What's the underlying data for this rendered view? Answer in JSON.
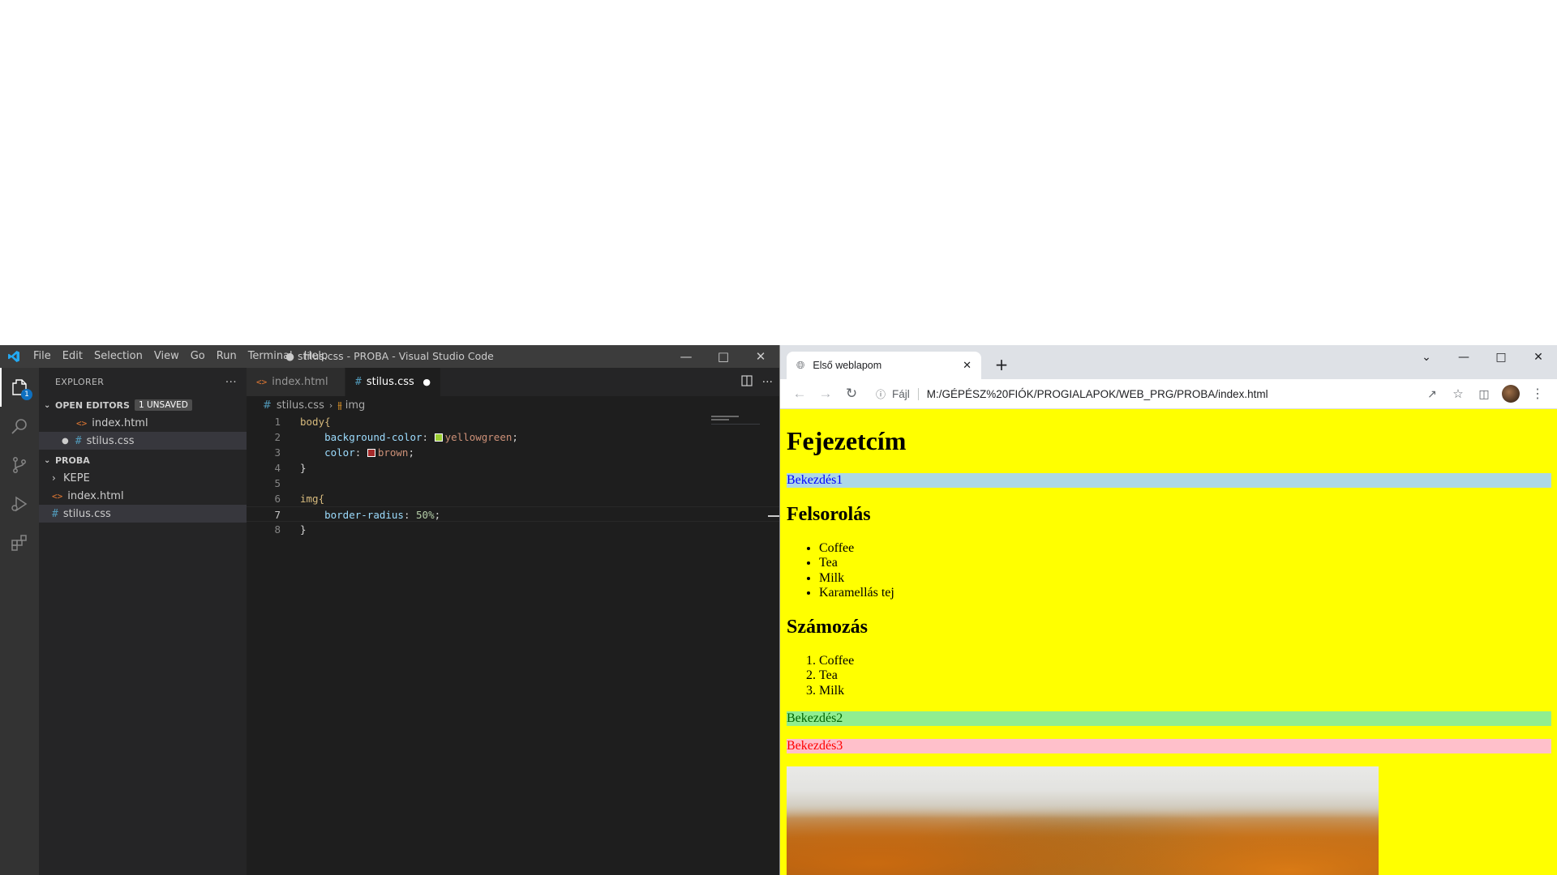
{
  "vscode": {
    "menu": [
      "File",
      "Edit",
      "Selection",
      "View",
      "Go",
      "Run",
      "Terminal",
      "Help"
    ],
    "window_title": "● stilus.css - PROBA - Visual Studio Code",
    "activity_badge": "1",
    "explorer_title": "EXPLORER",
    "open_editors_label": "OPEN EDITORS",
    "unsaved_badge": "1 UNSAVED",
    "open_editors": [
      "index.html",
      "stilus.css"
    ],
    "project_label": "PROBA",
    "folder": "KEPE",
    "files": [
      "index.html",
      "stilus.css"
    ],
    "tabs": [
      "index.html",
      "stilus.css"
    ],
    "breadcrumb": {
      "file": "stilus.css",
      "symbol": "img"
    },
    "line_numbers": [
      "1",
      "2",
      "3",
      "4",
      "5",
      "6",
      "7",
      "8"
    ],
    "code": {
      "l1_sel": "body{",
      "l2_prop": "background-color",
      "l2_val": "yellowgreen",
      "l3_prop": "color",
      "l3_val": "brown",
      "l4": "}",
      "l6_sel": "img{",
      "l7_prop": "border-radius",
      "l7_val": "50%",
      "l8": "}"
    },
    "swatch_colors": {
      "yellowgreen": "#9acd32",
      "brown": "#a52a2a"
    }
  },
  "chrome": {
    "tab_title": "Első weblapom",
    "scheme_label": "Fájl",
    "url": "M:/GÉPÉSZ%20FIÓK/PROGIALAPOK/WEB_PRG/PROBA/index.html",
    "page": {
      "h1": "Fejezetcím",
      "p1": "Bekezdés1",
      "h2_list": "Felsorolás",
      "ul": [
        "Coffee",
        "Tea",
        "Milk",
        "Karamellás tej"
      ],
      "h2_ol": "Számozás",
      "ol": [
        "Coffee",
        "Tea",
        "Milk"
      ],
      "p2": "Bekezdés2",
      "p3": "Bekezdés3"
    }
  },
  "colors": {
    "page_background": "#ffff00",
    "vscode_accent": "#0e70c0"
  }
}
